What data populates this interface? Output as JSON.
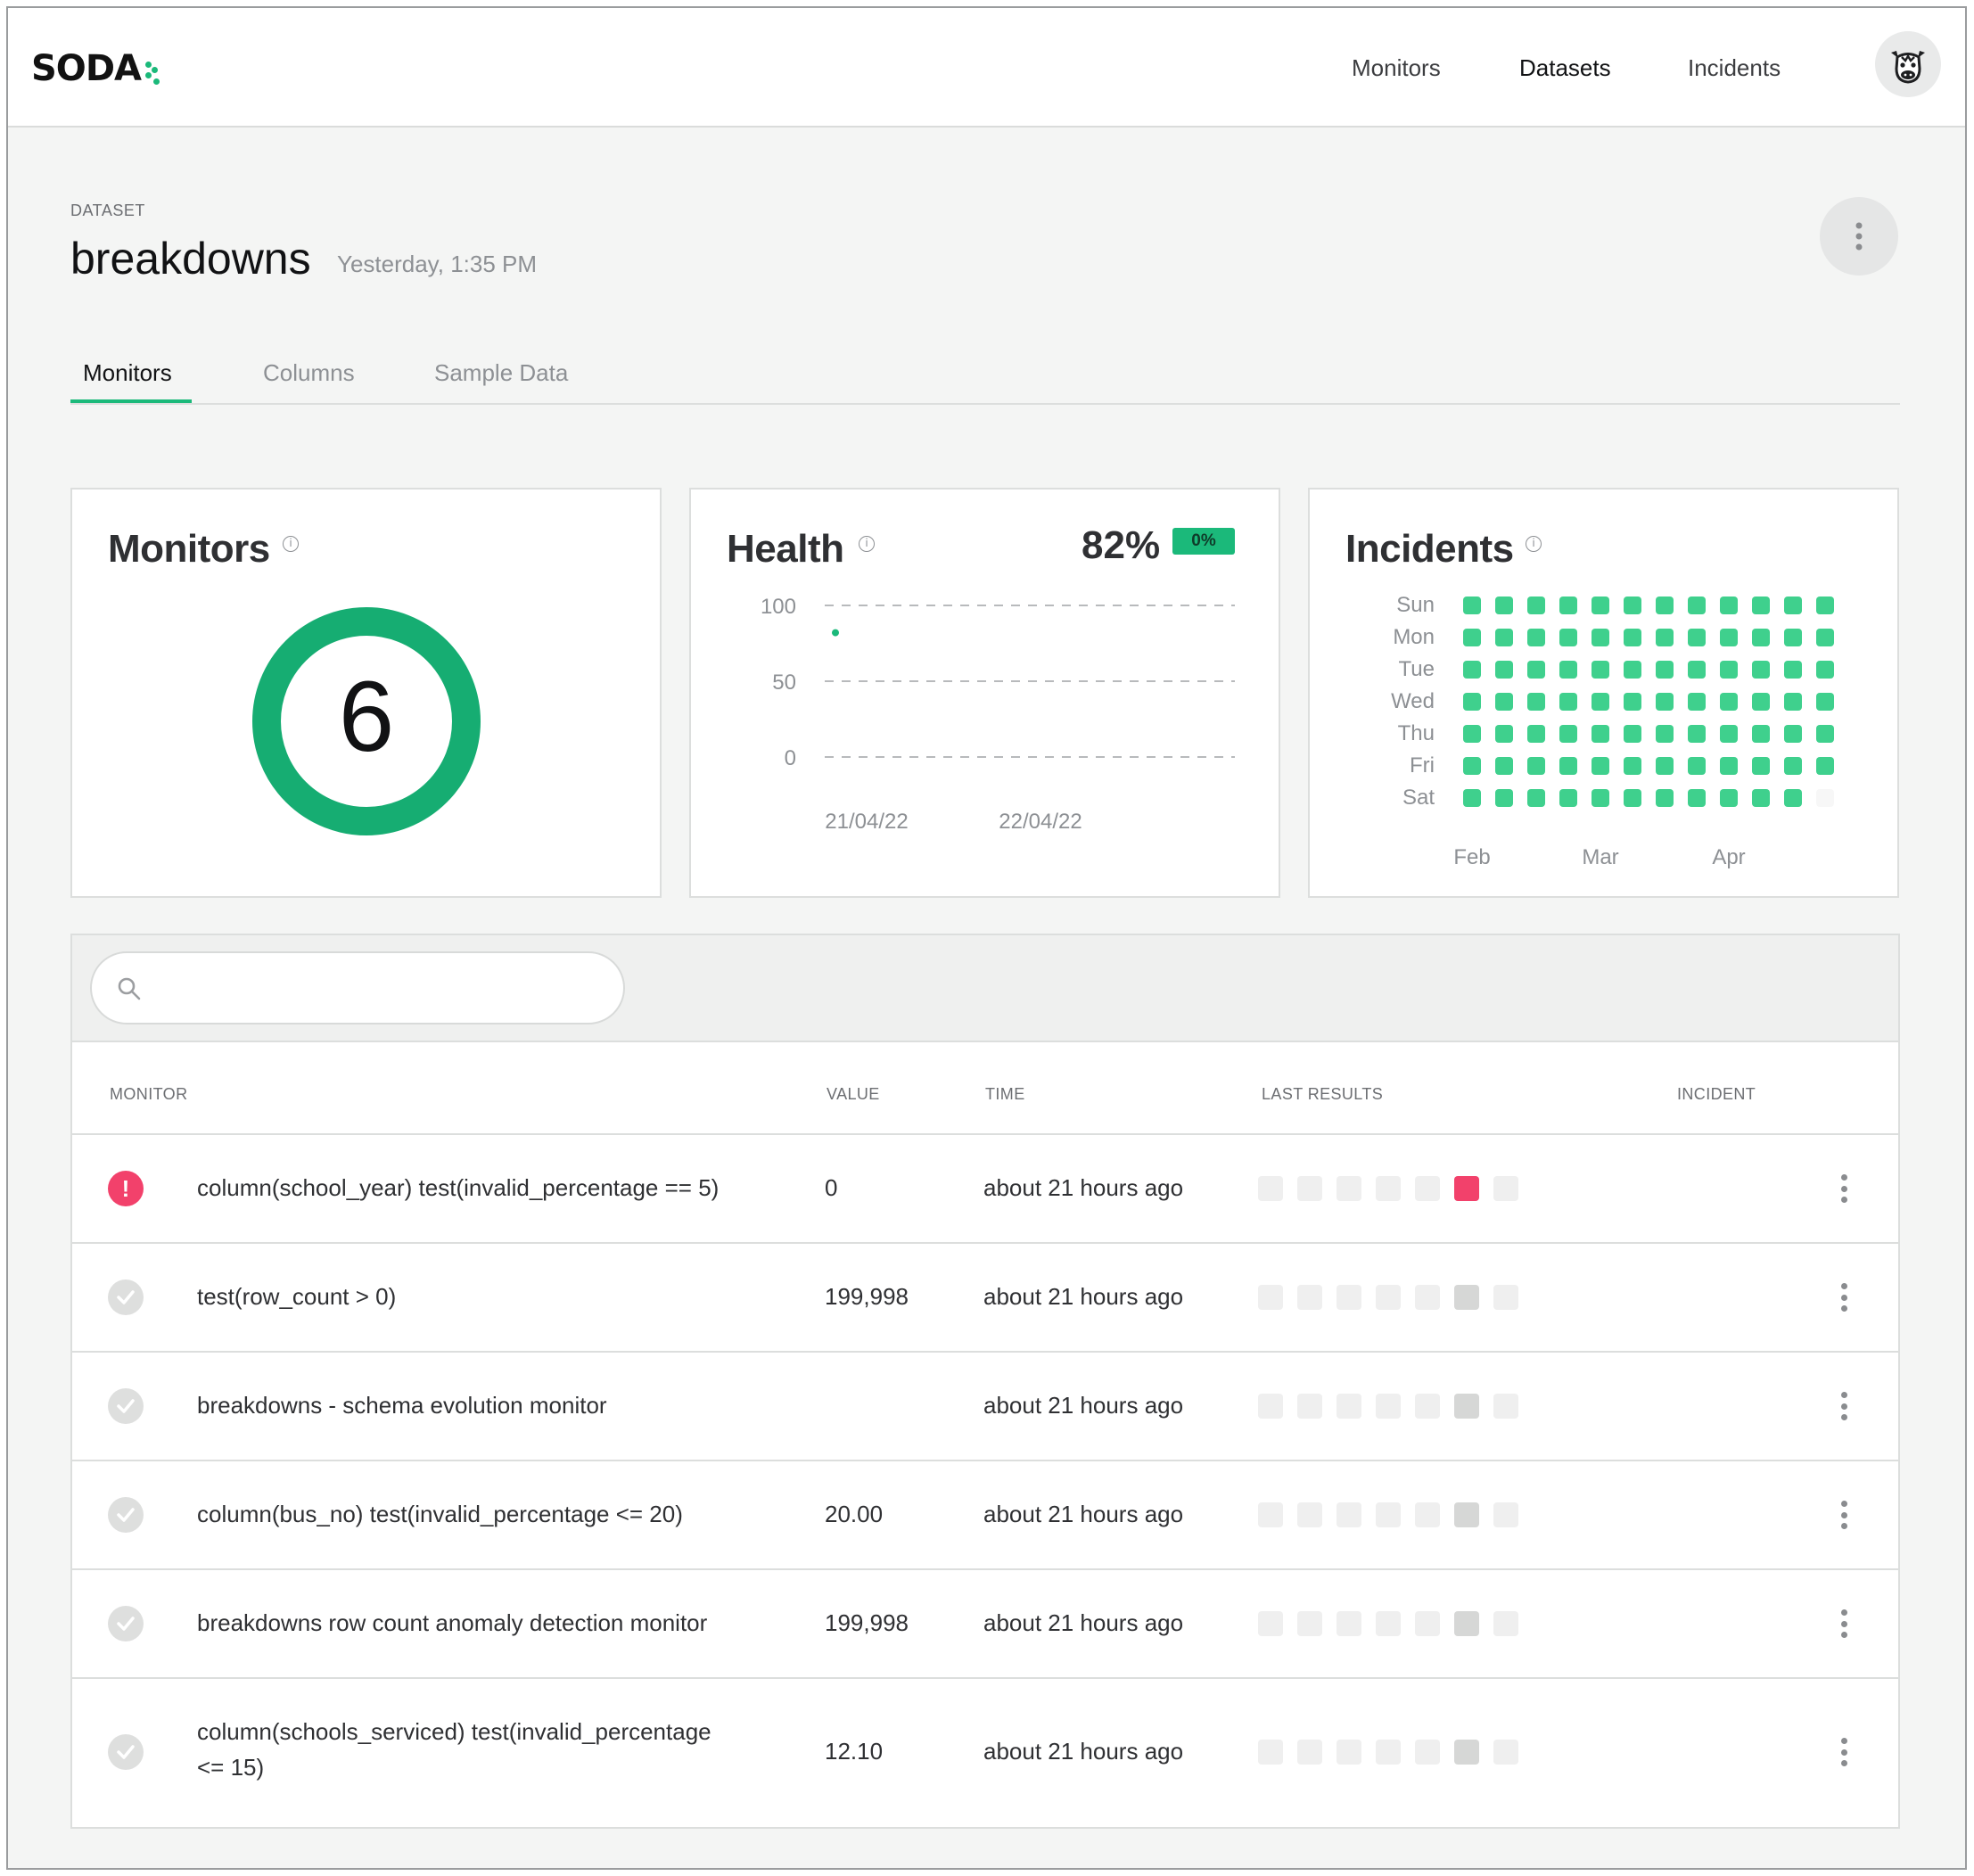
{
  "brand": {
    "name": "SODA",
    "accent": "#1bb97a",
    "danger": "#f2416b"
  },
  "nav": {
    "monitors": "Monitors",
    "datasets": "Datasets",
    "incidents": "Incidents",
    "active": "Datasets",
    "avatar_icon": "cow-avatar-icon"
  },
  "header": {
    "eyebrow": "DATASET",
    "title": "breakdowns",
    "updated": "Yesterday, 1:35 PM"
  },
  "tabs": [
    {
      "label": "Monitors",
      "active": true
    },
    {
      "label": "Columns",
      "active": false
    },
    {
      "label": "Sample Data",
      "active": false
    }
  ],
  "cards": {
    "monitors": {
      "title": "Monitors",
      "count": "6"
    },
    "health": {
      "title": "Health",
      "value": "82%",
      "change": "0%"
    },
    "incidents": {
      "title": "Incidents"
    }
  },
  "chart_data": [
    {
      "type": "scatter",
      "title": "Health",
      "ylim": [
        0,
        100
      ],
      "y_ticks": [
        "100",
        "50",
        "0"
      ],
      "x_ticks": [
        "21/04/22",
        "22/04/22"
      ],
      "grid": true,
      "series": [
        {
          "x": [
            "21/04/22"
          ],
          "y": [
            82
          ]
        }
      ]
    },
    {
      "type": "heatmap",
      "title": "Incidents",
      "rows": [
        "Sun",
        "Mon",
        "Tue",
        "Wed",
        "Thu",
        "Fri",
        "Sat"
      ],
      "x_ticks": [
        "Feb",
        "Mar",
        "Apr"
      ],
      "weeks": 12,
      "values": [
        [
          0,
          0,
          0,
          0,
          0,
          0,
          0,
          0,
          0,
          0,
          0,
          0
        ],
        [
          0,
          0,
          0,
          0,
          0,
          0,
          0,
          0,
          0,
          0,
          0,
          0
        ],
        [
          0,
          0,
          0,
          0,
          0,
          0,
          0,
          0,
          0,
          0,
          0,
          0
        ],
        [
          0,
          0,
          0,
          0,
          0,
          0,
          0,
          0,
          0,
          0,
          0,
          0
        ],
        [
          0,
          0,
          0,
          0,
          0,
          0,
          0,
          0,
          0,
          0,
          0,
          0
        ],
        [
          0,
          0,
          0,
          0,
          0,
          0,
          0,
          0,
          0,
          0,
          0,
          0
        ],
        [
          0,
          0,
          0,
          0,
          0,
          0,
          0,
          0,
          0,
          0,
          0,
          null
        ]
      ]
    }
  ],
  "search": {
    "placeholder": ""
  },
  "table": {
    "columns": {
      "monitor": "MONITOR",
      "value": "VALUE",
      "time": "TIME",
      "last_results": "LAST RESULTS",
      "incident": "INCIDENT"
    },
    "rows": [
      {
        "status": "fail",
        "monitor": "column(school_year) test(invalid_percentage == 5)",
        "value": "0",
        "time": "about 21 hours ago",
        "results": [
          "none",
          "none",
          "none",
          "none",
          "none",
          "fail",
          "none"
        ]
      },
      {
        "status": "pass",
        "monitor": "test(row_count > 0)",
        "value": "199,998",
        "time": "about 21 hours ago",
        "results": [
          "none",
          "none",
          "none",
          "none",
          "none",
          "pass",
          "none"
        ]
      },
      {
        "status": "pass",
        "monitor": "breakdowns - schema evolution monitor",
        "value": "",
        "time": "about 21 hours ago",
        "results": [
          "none",
          "none",
          "none",
          "none",
          "none",
          "pass",
          "none"
        ]
      },
      {
        "status": "pass",
        "monitor": "column(bus_no) test(invalid_percentage <= 20)",
        "value": "20.00",
        "time": "about 21 hours ago",
        "results": [
          "none",
          "none",
          "none",
          "none",
          "none",
          "pass",
          "none"
        ]
      },
      {
        "status": "pass",
        "monitor": "breakdowns row count anomaly detection monitor",
        "value": "199,998",
        "time": "about 21 hours ago",
        "results": [
          "none",
          "none",
          "none",
          "none",
          "none",
          "pass",
          "none"
        ]
      },
      {
        "status": "pass",
        "monitor_line1": "column(schools_serviced) test(invalid_percentage",
        "monitor_line2": "<= 15)",
        "value": "12.10",
        "time": "about 21 hours ago",
        "results": [
          "none",
          "none",
          "none",
          "none",
          "none",
          "pass",
          "none"
        ]
      }
    ]
  }
}
